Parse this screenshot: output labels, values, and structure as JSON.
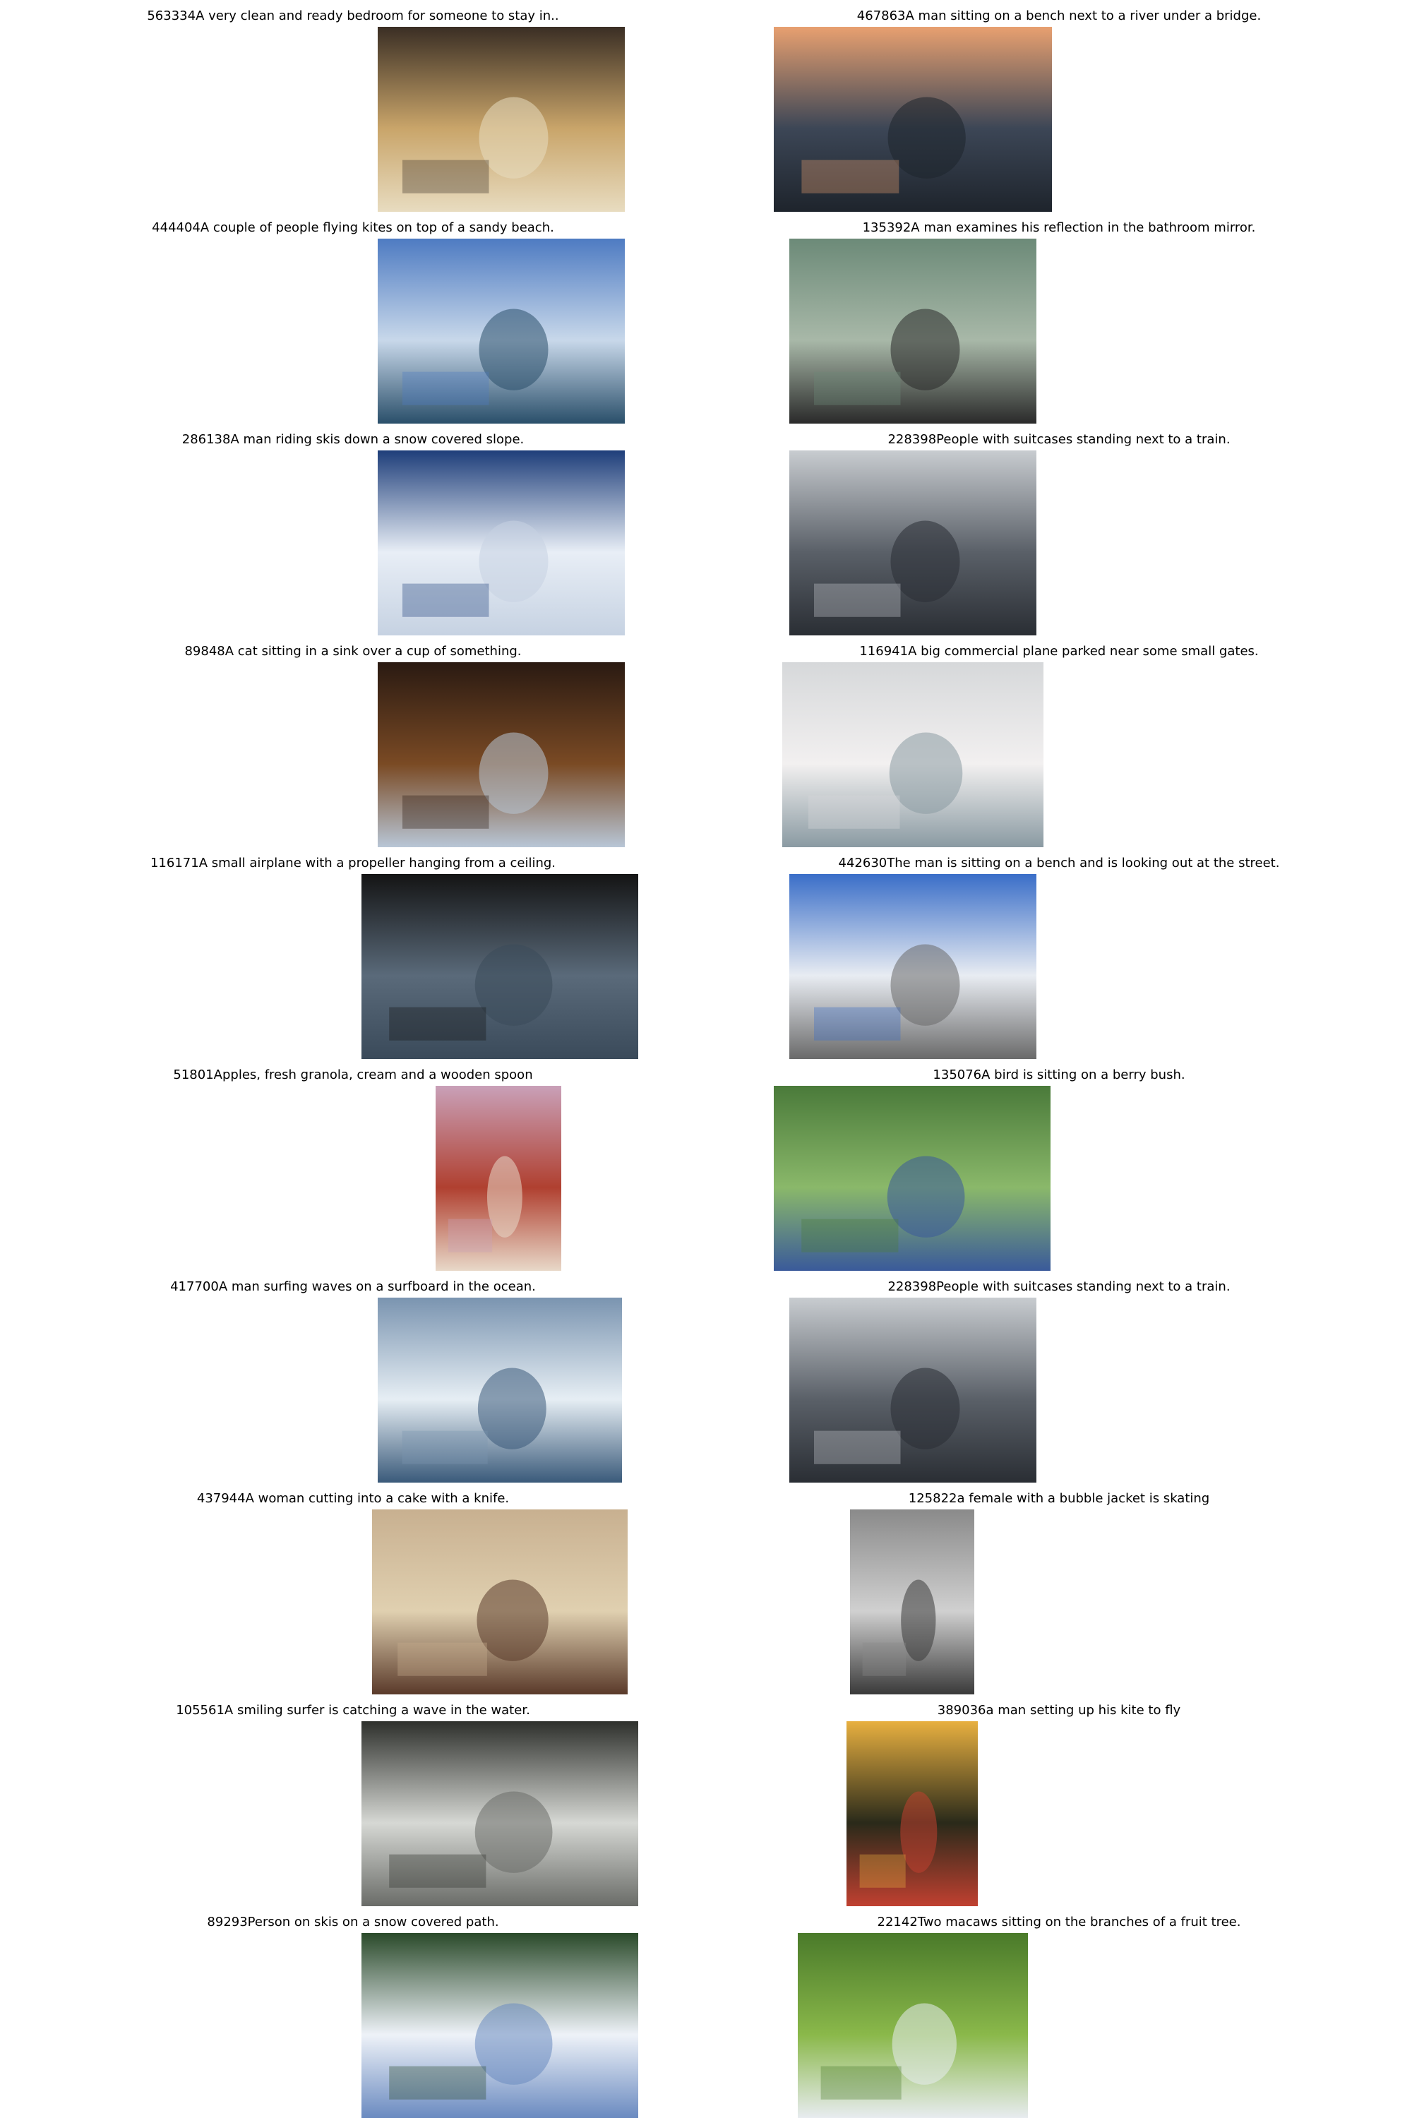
{
  "grid": {
    "items": [
      {
        "caption": "563334A very clean and ready bedroom for someone to stay in..",
        "scene": "bedroom"
      },
      {
        "caption": "467863A man sitting on a bench next to a river under a bridge.",
        "scene": "bridge"
      },
      {
        "caption": "444404A couple of people flying kites on top of a sandy beach.",
        "scene": "beach"
      },
      {
        "caption": "135392A man examines his reflection in the bathroom mirror.",
        "scene": "mirror"
      },
      {
        "caption": "286138A man riding skis down a snow covered slope.",
        "scene": "snow-slope"
      },
      {
        "caption": "228398People with suitcases standing next to a train.",
        "scene": "train"
      },
      {
        "caption": "89848A cat sitting in a sink over a cup of something.",
        "scene": "cat"
      },
      {
        "caption": "116941A big commercial plane parked near some small gates.",
        "scene": "plane"
      },
      {
        "caption": "116171A small airplane with a propeller hanging from a ceiling.",
        "scene": "museum"
      },
      {
        "caption": "442630The man is sitting on a bench and is looking out at the street.",
        "scene": "street"
      },
      {
        "caption": "51801Apples, fresh granola, cream and a wooden spoon",
        "scene": "food"
      },
      {
        "caption": "135076A bird is sitting on a berry bush.",
        "scene": "bird"
      },
      {
        "caption": "417700A man surfing waves on a surfboard in the ocean.",
        "scene": "surf"
      },
      {
        "caption": "228398People with suitcases standing next to a train.",
        "scene": "train"
      },
      {
        "caption": "437944A woman cutting into a cake with a knife.",
        "scene": "party"
      },
      {
        "caption": "125822a female with a bubble jacket is skating",
        "scene": "skate"
      },
      {
        "caption": "105561A smiling surfer is catching a wave in the water.",
        "scene": "river-surf"
      },
      {
        "caption": "389036a man setting up his kite to fly",
        "scene": "kite"
      },
      {
        "caption": "89293Person on skis on a snow covered path.",
        "scene": "ski-forest"
      },
      {
        "caption": "22142Two macaws sitting on the branches of a fruit tree.",
        "scene": "tree"
      }
    ]
  },
  "scene_colors": {
    "bedroom": [
      "#3a2e24",
      "#c9a56a",
      "#e8dcc0"
    ],
    "bridge": [
      "#e8a070",
      "#3c4656",
      "#1e242c"
    ],
    "beach": [
      "#4e7bc2",
      "#c8d8ea",
      "#2a4f6a"
    ],
    "mirror": [
      "#6c8a78",
      "#a8b8a8",
      "#2a2a2a"
    ],
    "snow-slope": [
      "#1e3e7a",
      "#e8eef6",
      "#c6d2e2"
    ],
    "train": [
      "#c8ccd0",
      "#5a6068",
      "#2a2e34"
    ],
    "cat": [
      "#2a1a12",
      "#7a4a24",
      "#b8c6d6"
    ],
    "plane": [
      "#d6d8da",
      "#f2f0f0",
      "#8a9aa2"
    ],
    "museum": [
      "#141414",
      "#5a6a7a",
      "#3a4a5a"
    ],
    "street": [
      "#3a6ec8",
      "#e8ecf2",
      "#6a6a6a"
    ],
    "food": [
      "#c9a0b8",
      "#b04030",
      "#e8d8c8"
    ],
    "bird": [
      "#4a7a3a",
      "#8ab86a",
      "#3a5a9a"
    ],
    "surf": [
      "#7a94b0",
      "#e6eef4",
      "#3a5a7a"
    ],
    "party": [
      "#c8b090",
      "#e0d0b0",
      "#5a3a2a"
    ],
    "skate": [
      "#8a8a8a",
      "#d0d0d0",
      "#3a3a3a"
    ],
    "river-surf": [
      "#2e302c",
      "#d6d8d4",
      "#6a6c68"
    ],
    "kite": [
      "#e8b040",
      "#2a2a1a",
      "#c04030"
    ],
    "ski-forest": [
      "#2a4a2a",
      "#eef2f8",
      "#6a8ac0"
    ],
    "tree": [
      "#4a7a2a",
      "#8ab84a",
      "#e8ecf0"
    ]
  }
}
